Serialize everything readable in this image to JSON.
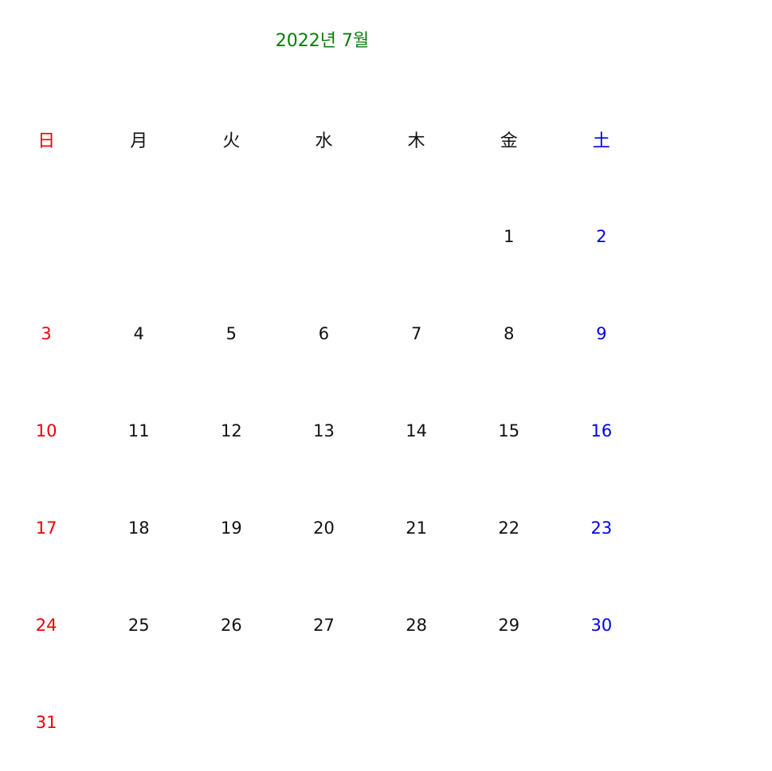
{
  "calendar": {
    "title": "2022년 7월",
    "colors": {
      "title": "#0a7a0a",
      "sunday": "#e8000b",
      "saturday": "#0000e6",
      "weekday": "#111111"
    },
    "weekdays": [
      "日",
      "月",
      "火",
      "水",
      "木",
      "金",
      "土"
    ],
    "weeks": [
      [
        "",
        "",
        "",
        "",
        "",
        "1",
        "2"
      ],
      [
        "3",
        "4",
        "5",
        "6",
        "7",
        "8",
        "9"
      ],
      [
        "10",
        "11",
        "12",
        "13",
        "14",
        "15",
        "16"
      ],
      [
        "17",
        "18",
        "19",
        "20",
        "21",
        "22",
        "23"
      ],
      [
        "24",
        "25",
        "26",
        "27",
        "28",
        "29",
        "30"
      ],
      [
        "31",
        "",
        "",
        "",
        "",
        "",
        ""
      ]
    ]
  }
}
